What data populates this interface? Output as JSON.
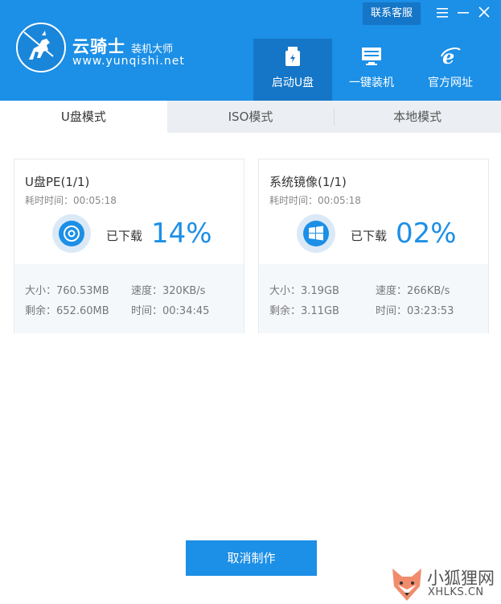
{
  "header": {
    "brand_name": "云骑士",
    "brand_sub": "装机大师",
    "brand_url": "www.yunqishi.net",
    "service_label": "联系客服",
    "window_controls": [
      "menu-icon",
      "minimize-icon",
      "close-icon"
    ],
    "nav": [
      {
        "label": "启动U盘",
        "icon": "usb-drive-icon",
        "active": true
      },
      {
        "label": "一键装机",
        "icon": "monitor-icon",
        "active": false
      },
      {
        "label": "官方网址",
        "icon": "ie-browser-icon",
        "active": false
      }
    ]
  },
  "tabs": [
    {
      "label": "U盘模式",
      "active": true
    },
    {
      "label": "ISO模式",
      "active": false
    },
    {
      "label": "本地模式",
      "active": false
    }
  ],
  "cards": [
    {
      "title": "U盘PE(1/1)",
      "elapsed": "耗时时间：00:05:18",
      "icon": "disc-icon",
      "status": "已下载",
      "percent": "14%",
      "size": "大小：760.53MB",
      "remaining": "剩余：652.60MB",
      "speed": "速度：320KB/s",
      "time": "时间：00:34:45"
    },
    {
      "title": "系统镜像(1/1)",
      "elapsed": "耗时时间：00:05:18",
      "icon": "windows-logo-icon",
      "status": "已下载",
      "percent": "02%",
      "size": "大小：3.19GB",
      "remaining": "剩余：3.11GB",
      "speed": "速度：266KB/s",
      "time": "时间：03:23:53"
    }
  ],
  "cancel_label": "取消制作",
  "watermark": {
    "title": "小狐狸网",
    "url": "XHLKS.CN"
  },
  "colors": {
    "accent": "#1c8fe6",
    "accent_dark": "#1576c7",
    "tab_bg": "#ebeff3"
  }
}
